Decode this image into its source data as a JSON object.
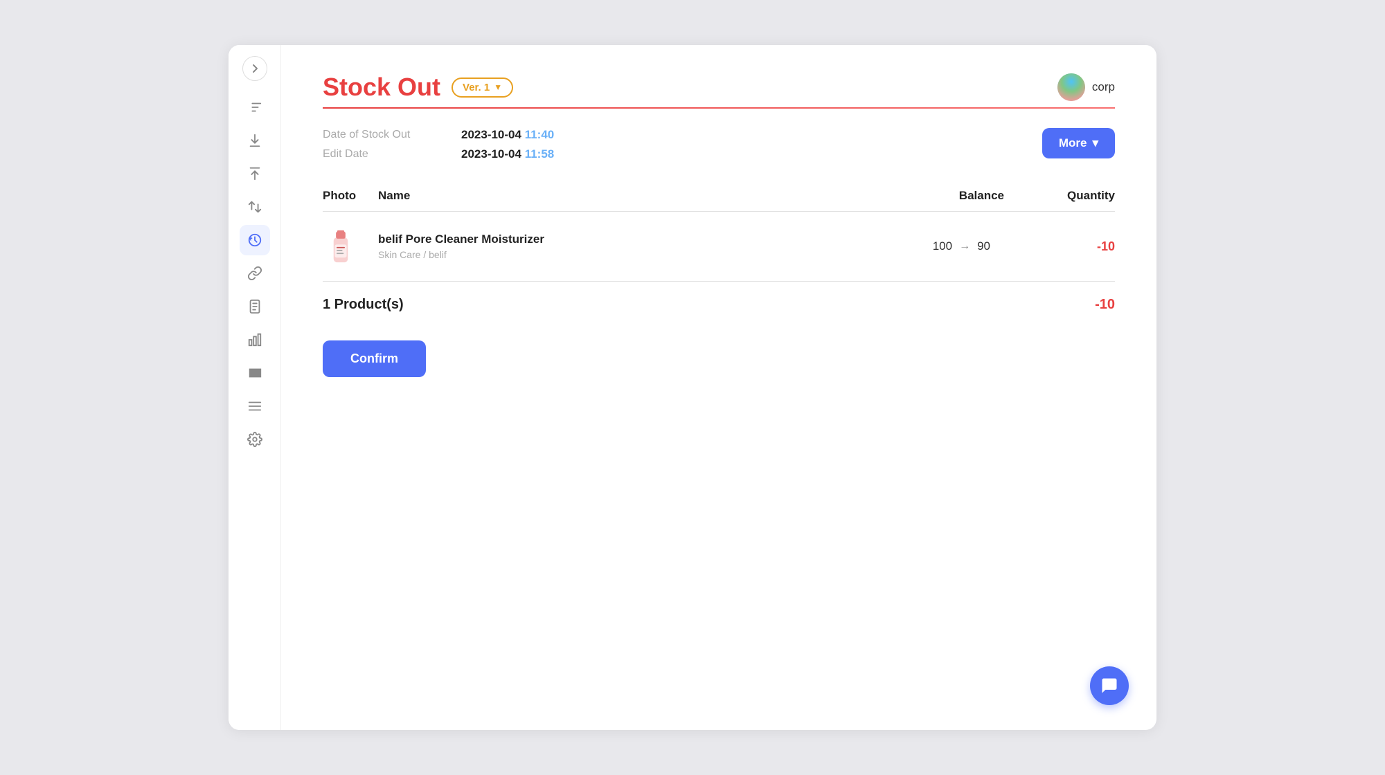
{
  "page": {
    "title": "Stock Out",
    "version": {
      "label": "Ver. 1"
    },
    "user": {
      "name": "corp"
    }
  },
  "meta": {
    "date_of_stock_out_label": "Date of Stock Out",
    "date_of_stock_out_date": "2023-10-04",
    "date_of_stock_out_time": "11:40",
    "edit_date_label": "Edit Date",
    "edit_date_date": "2023-10-04",
    "edit_date_time": "11:58"
  },
  "more_button": "More",
  "table": {
    "headers": {
      "photo": "Photo",
      "name": "Name",
      "balance": "Balance",
      "quantity": "Quantity"
    },
    "rows": [
      {
        "product_name": "belif Pore Cleaner Moisturizer",
        "product_category": "Skin Care / belif",
        "balance_from": "100",
        "balance_to": "90",
        "quantity": "-10"
      }
    ]
  },
  "summary": {
    "label": "1 Product(s)",
    "total": "-10"
  },
  "confirm_button": "Confirm",
  "sidebar": {
    "icons": [
      "↕",
      "⬇",
      "⬆",
      "↕",
      "↺",
      "🔗",
      "📋",
      "📊",
      "▦",
      "☰",
      "⚙"
    ]
  }
}
